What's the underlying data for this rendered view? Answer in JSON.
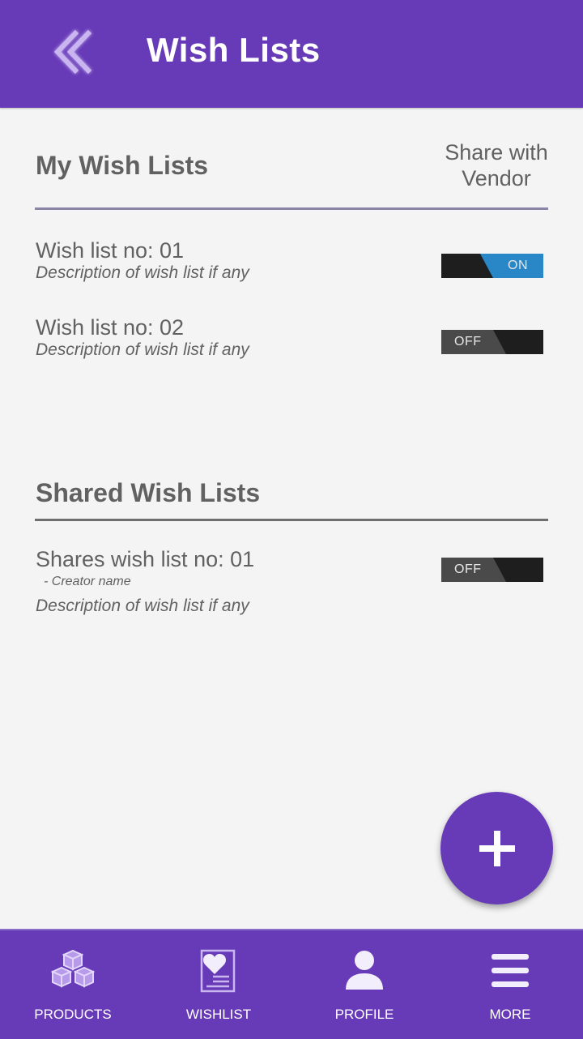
{
  "header": {
    "title": "Wish Lists",
    "back_icon": "double-chevron-left-icon"
  },
  "my_lists": {
    "section_title": "My Wish Lists",
    "share_column_label_line1": "Share with",
    "share_column_label_line2": "Vendor",
    "items": [
      {
        "title": "Wish list no: 01",
        "description": "Description of wish list if any",
        "toggle_state": "ON"
      },
      {
        "title": "Wish list no: 02",
        "description": "Description of wish list if any",
        "toggle_state": "OFF"
      }
    ]
  },
  "shared_lists": {
    "section_title": "Shared Wish Lists",
    "items": [
      {
        "title": "Shares wish list no: 01",
        "creator": "- Creator name",
        "description": "Description of wish list if any",
        "toggle_state": "OFF"
      }
    ]
  },
  "fab": {
    "icon": "plus-icon"
  },
  "bottom_nav": [
    {
      "label": "PRODUCTS",
      "icon": "boxes-icon"
    },
    {
      "label": "WISHLIST",
      "icon": "heart-list-icon"
    },
    {
      "label": "PROFILE",
      "icon": "person-icon"
    },
    {
      "label": "MORE",
      "icon": "menu-icon"
    }
  ],
  "colors": {
    "primary": "#673ab7",
    "toggle_on": "#2a87c7",
    "toggle_track": "#1e1e1e",
    "text": "#616161",
    "background": "#f4f4f4",
    "divider_my_lists": "#8a84a8",
    "divider_shared": "#6e6e6e"
  }
}
